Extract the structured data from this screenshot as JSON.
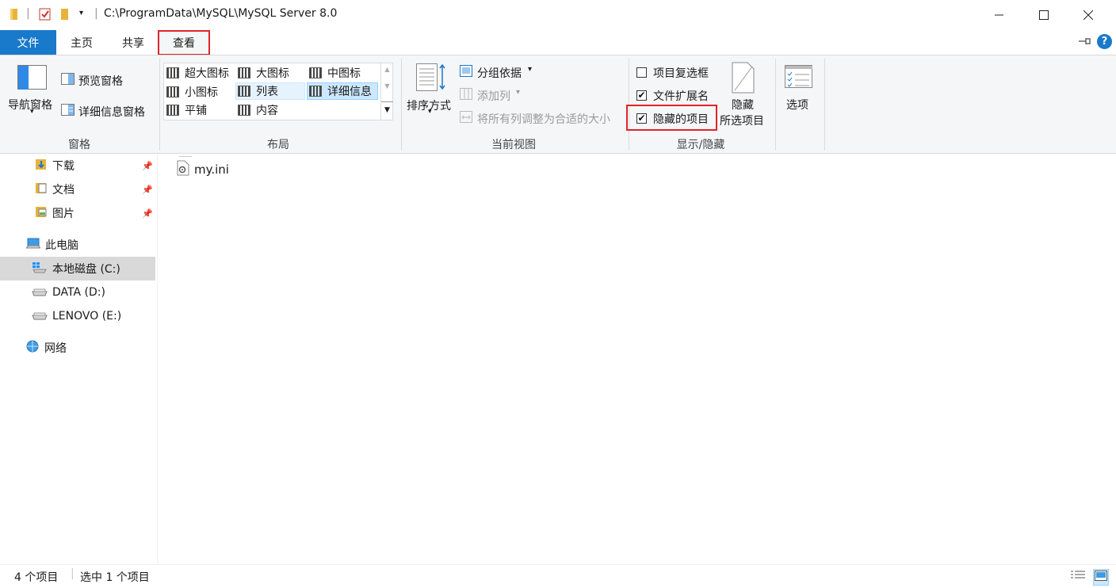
{
  "window": {
    "path": "C:\\ProgramData\\MySQL\\MySQL Server 8.0",
    "controls": {
      "minimize": "—",
      "maximize": "☐",
      "close": "✕"
    }
  },
  "tabs": [
    {
      "label": "文件"
    },
    {
      "label": "主页"
    },
    {
      "label": "共享"
    },
    {
      "label": "查看"
    }
  ],
  "ribbon": {
    "panes": {
      "nav_pane": "导航窗格",
      "preview_pane": "预览窗格",
      "details_pane": "详细信息窗格",
      "group_label": "窗格"
    },
    "layout": {
      "items": [
        "超大图标",
        "大图标",
        "中图标",
        "小图标",
        "列表",
        "详细信息",
        "平铺",
        "内容"
      ],
      "selected": "详细信息",
      "group_label": "布局"
    },
    "current_view": {
      "sort_by": "排序方式",
      "group_by": "分组依据",
      "add_columns": "添加列",
      "fit_columns": "将所有列调整为合适的大小",
      "group_label": "当前视图"
    },
    "show_hide": {
      "item_checkboxes": {
        "label": "项目复选框",
        "checked": false
      },
      "file_extensions": {
        "label": "文件扩展名",
        "checked": true
      },
      "hidden_items": {
        "label": "隐藏的项目",
        "checked": true
      },
      "hide_selected_1": "隐藏",
      "hide_selected_2": "所选项目",
      "group_label": "显示/隐藏"
    },
    "options": "选项"
  },
  "nav": {
    "quick_access": [
      {
        "label": "下载",
        "pinned": true
      },
      {
        "label": "文档",
        "pinned": true
      },
      {
        "label": "图片",
        "pinned": true
      }
    ],
    "this_pc": "此电脑",
    "drives": [
      {
        "label": "本地磁盘 (C:)",
        "selected": true
      },
      {
        "label": "DATA (D:)",
        "selected": false
      },
      {
        "label": "LENOVO (E:)",
        "selected": false
      }
    ],
    "network": "网络"
  },
  "files": [
    {
      "name": "my.ini"
    }
  ],
  "status": {
    "item_count": "4 个项目",
    "selected": "选中 1 个项目"
  },
  "colors": {
    "file_tab": "#1979ca",
    "highlight_box": "#e0242a",
    "ribbon_bg": "#f5f6f7",
    "selection": "#cce8ff"
  }
}
